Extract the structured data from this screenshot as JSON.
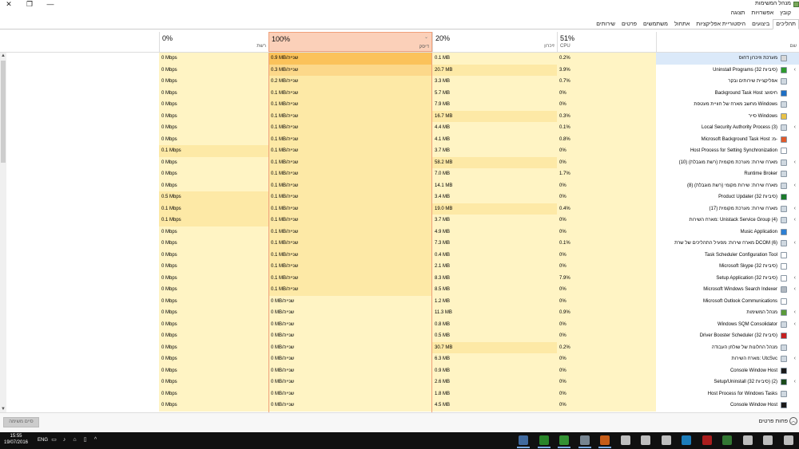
{
  "window": {
    "title": "מנהל המשימות",
    "close_label": "✕",
    "restore_label": "❐",
    "minimize_label": "—"
  },
  "menu": [
    "קובץ",
    "אפשרויות",
    "תצוגה"
  ],
  "tabs": [
    {
      "label": "תהליכים",
      "active": true
    },
    {
      "label": "ביצועים",
      "active": false
    },
    {
      "label": "היסטוריית אפליקציות",
      "active": false
    },
    {
      "label": "אתחול",
      "active": false
    },
    {
      "label": "משתמשים",
      "active": false
    },
    {
      "label": "פרטים",
      "active": false
    },
    {
      "label": "שירותים",
      "active": false
    }
  ],
  "columns": {
    "name": {
      "label": "שם"
    },
    "cpu": {
      "percent": "51%",
      "label": "CPU"
    },
    "memory": {
      "percent": "20%",
      "label": "זיכרון"
    },
    "disk": {
      "percent": "100%",
      "label": "דיסק"
    },
    "network": {
      "percent": "0%",
      "label": "רשת"
    }
  },
  "processes": [
    {
      "name": "מערכת וזיכרון דחוס",
      "cpu": "0.2%",
      "mem": "0.1 MB",
      "disk": "0.9 MB/שנייה",
      "net": "0 Mbps",
      "icon": "system-icon",
      "icon_color": "#d8d8d8",
      "expand": false,
      "selected": true
    },
    {
      "name": "Uninstall Programs (32 סיביות)",
      "cpu": "3.9%",
      "mem": "20.7 MB",
      "disk": "0.3 MB/שנייה",
      "net": "0 Mbps",
      "icon": "green-circle-icon",
      "icon_color": "#2e9a2e",
      "expand": true
    },
    {
      "name": "אפליקציית שירותים ובקר",
      "cpu": "0.7%",
      "mem": "3.3 MB",
      "disk": "0.2 MB/שנייה",
      "net": "0 Mbps",
      "icon": "services-icon",
      "icon_color": "#cfd8e0",
      "expand": false
    },
    {
      "name": "Background Task Host :חיפוש",
      "cpu": "0%",
      "mem": "5.7 MB",
      "disk": "0.1 MB/שנייה",
      "net": "0 Mbps",
      "icon": "search-app-icon",
      "icon_color": "#1e6fc4",
      "expand": false
    },
    {
      "name": "מחשב מארח של חוויית מעטפת Windows",
      "cpu": "0%",
      "mem": "7.9 MB",
      "disk": "0.1 MB/שנייה",
      "net": "0 Mbps",
      "icon": "window-frame-icon",
      "icon_color": "#cfd8e0",
      "expand": false
    },
    {
      "name": "סייר Windows",
      "cpu": "0.3%",
      "mem": "16.7 MB",
      "disk": "0.1 MB/שנייה",
      "net": "0 Mbps",
      "icon": "folder-icon",
      "icon_color": "#e8c248",
      "expand": false
    },
    {
      "name": "Local Security Authority Process (3)",
      "cpu": "0.1%",
      "mem": "4.4 MB",
      "disk": "0.1 MB/שנייה",
      "net": "0 Mbps",
      "icon": "window-frame-icon",
      "icon_color": "#cfd8e0",
      "expand": true
    },
    {
      "name": "Microsoft Background Task Host :מ-",
      "cpu": "0.8%",
      "mem": "4.1 MB",
      "disk": "0.1 MB/שנייה",
      "net": "0 Mbps",
      "icon": "windows-logo-icon",
      "icon_color": "#e05a2b",
      "expand": false
    },
    {
      "name": "Host Process for Setting Synchronization",
      "cpu": "0%",
      "mem": "3.7 MB",
      "disk": "0.1 MB/שנייה",
      "net": "0.1 Mbps",
      "icon": "window-frame-icon",
      "icon_color": "#ffffff",
      "expand": false
    },
    {
      "name": "מארח שירות: מערכת מקומית (רשת מוגבלת) (10)",
      "cpu": "0%",
      "mem": "58.2 MB",
      "disk": "0.1 MB/שנייה",
      "net": "0 Mbps",
      "icon": "service-host-icon",
      "icon_color": "#cfd8e0",
      "expand": true
    },
    {
      "name": "Runtime Broker",
      "cpu": "1.7%",
      "mem": "7.0 MB",
      "disk": "0.1 MB/שנייה",
      "net": "0 Mbps",
      "icon": "window-frame-icon",
      "icon_color": "#cfd8e0",
      "expand": false
    },
    {
      "name": "מארח שירות: שירות מקומי (רשת מוגבלת) (8)",
      "cpu": "0%",
      "mem": "14.1 MB",
      "disk": "0.1 MB/שנייה",
      "net": "0 Mbps",
      "icon": "service-host-icon",
      "icon_color": "#cfd8e0",
      "expand": true
    },
    {
      "name": "Product Updater (32 סיביות)",
      "cpu": "0%",
      "mem": "3.4 MB",
      "disk": "0.1 MB/שנייה",
      "net": "0.5 Mbps",
      "icon": "updater-icon",
      "icon_color": "#1a7a2a",
      "expand": false
    },
    {
      "name": "מארח שירות: מערכת מקומית (17)",
      "cpu": "0.4%",
      "mem": "19.0 MB",
      "disk": "0.1 MB/שנייה",
      "net": "0.1 Mbps",
      "icon": "service-host-icon",
      "icon_color": "#cfd8e0",
      "expand": true
    },
    {
      "name": "מארח השירות: Unistack Service Group (4)",
      "cpu": "0%",
      "mem": "3.7 MB",
      "disk": "0.1 MB/שנייה",
      "net": "0.1 Mbps",
      "icon": "service-host-icon",
      "icon_color": "#cfd8e0",
      "expand": true
    },
    {
      "name": "Music Application",
      "cpu": "0%",
      "mem": "4.9 MB",
      "disk": "0.1 MB/שנייה",
      "net": "0 Mbps",
      "icon": "music-icon",
      "icon_color": "#2d7fd3",
      "expand": false
    },
    {
      "name": "מארח שירות: מפעיל התהליכים של שרת DCOM (6)",
      "cpu": "0.1%",
      "mem": "7.3 MB",
      "disk": "0.1 MB/שנייה",
      "net": "0 Mbps",
      "icon": "service-host-icon",
      "icon_color": "#cfd8e0",
      "expand": true
    },
    {
      "name": "Task Scheduler Configuration Tool",
      "cpu": "0%",
      "mem": "0.4 MB",
      "disk": "0.1 MB/שנייה",
      "net": "0 Mbps",
      "icon": "window-frame-icon",
      "icon_color": "#ffffff",
      "expand": false
    },
    {
      "name": "Microsoft Skype (32 סיביות)",
      "cpu": "0%",
      "mem": "2.1 MB",
      "disk": "0.1 MB/שנייה",
      "net": "0 Mbps",
      "icon": "skype-icon",
      "icon_color": "#ffffff",
      "expand": false
    },
    {
      "name": "Setup Application (32 סיביות)",
      "cpu": "7.9%",
      "mem": "8.3 MB",
      "disk": "0.1 MB/שנייה",
      "net": "0 Mbps",
      "icon": "setup-icon",
      "icon_color": "#ffffff",
      "expand": true
    },
    {
      "name": "Microsoft Windows Search Indexer",
      "cpu": "0%",
      "mem": "8.5 MB",
      "disk": "0.1 MB/שנייה",
      "net": "0 Mbps",
      "icon": "indexer-icon",
      "icon_color": "#b0b8c0",
      "expand": true
    },
    {
      "name": "Microsoft Outlook Communications",
      "cpu": "0%",
      "mem": "1.2 MB",
      "disk": "0 MB/שנייה",
      "net": "0 Mbps",
      "icon": "window-frame-icon",
      "icon_color": "#ffffff",
      "expand": false
    },
    {
      "name": "מנהל המשימות",
      "cpu": "0.9%",
      "mem": "11.3 MB",
      "disk": "0 MB/שנייה",
      "net": "0 Mbps",
      "icon": "task-manager-icon",
      "icon_color": "#5a9a3a",
      "expand": true
    },
    {
      "name": "Windows SQM Consolidator",
      "cpu": "0%",
      "mem": "0.8 MB",
      "disk": "0 MB/שנייה",
      "net": "0 Mbps",
      "icon": "window-frame-icon",
      "icon_color": "#cfd8e0",
      "expand": true
    },
    {
      "name": "Driver Booster Scheduler (32 סיביות)",
      "cpu": "0%",
      "mem": "0.5 MB",
      "disk": "0 MB/שנייה",
      "net": "0 Mbps",
      "icon": "driver-booster-icon",
      "icon_color": "#c62020",
      "expand": false
    },
    {
      "name": "מנהל החלונות של שולחן העבודה",
      "cpu": "0.2%",
      "mem": "30.7 MB",
      "disk": "0 MB/שנייה",
      "net": "0 Mbps",
      "icon": "window-frame-icon",
      "icon_color": "#cfd8e0",
      "expand": false
    },
    {
      "name": "מארח השירות: UtcSvc",
      "cpu": "0%",
      "mem": "6.3 MB",
      "disk": "0 MB/שנייה",
      "net": "0 Mbps",
      "icon": "service-host-icon",
      "icon_color": "#cfd8e0",
      "expand": true
    },
    {
      "name": "Console Window Host",
      "cpu": "0%",
      "mem": "0.9 MB",
      "disk": "0 MB/שנייה",
      "net": "0 Mbps",
      "icon": "console-icon",
      "icon_color": "#1a1a1a",
      "expand": false
    },
    {
      "name": "Setup/Uninstall (32 סיביות) (2)",
      "cpu": "0%",
      "mem": "2.6 MB",
      "disk": "0 MB/שנייה",
      "net": "0 Mbps",
      "icon": "setup-uninstall-icon",
      "icon_color": "#1a4a1a",
      "expand": true
    },
    {
      "name": "Host Process for Windows Tasks",
      "cpu": "0%",
      "mem": "1.8 MB",
      "disk": "0 MB/שנייה",
      "net": "0 Mbps",
      "icon": "window-frame-icon",
      "icon_color": "#cfd8e0",
      "expand": false
    },
    {
      "name": "Console Window Host",
      "cpu": "0%",
      "mem": "4.5 MB",
      "disk": "0 MB/שנייה",
      "net": "0 Mbps",
      "icon": "console-icon",
      "icon_color": "#1a1a1a",
      "expand": false
    }
  ],
  "footer": {
    "fewer_details": "פחות פרטים",
    "end_task": "סיים משימה"
  },
  "taskbar": {
    "time": "15:55",
    "date": "19/07/2016",
    "language": "ENG",
    "pinned": [
      {
        "name": "task-view-icon",
        "color": "#4a7ab8"
      },
      {
        "name": "green-circle-app-icon",
        "color": "#2e9a2e"
      },
      {
        "name": "uninstall-app-icon",
        "color": "#3aa83a"
      },
      {
        "name": "task-manager-app-icon",
        "color": "#8a9aa8"
      },
      {
        "name": "firefox-icon",
        "color": "#e66a1a"
      },
      {
        "name": "mo-app-icon",
        "color": "#dddddd"
      },
      {
        "name": "mail-icon",
        "color": "#dddddd"
      },
      {
        "name": "store-icon",
        "color": "#dddddd"
      },
      {
        "name": "skype-app-icon",
        "color": "#1e8fd8"
      },
      {
        "name": "driver-booster-app-icon",
        "color": "#c62020"
      },
      {
        "name": "photos-icon",
        "color": "#3a8a3a"
      },
      {
        "name": "tablet-icon",
        "color": "#dddddd"
      },
      {
        "name": "explorer-icon",
        "color": "#dddddd"
      },
      {
        "name": "search-icon",
        "color": "#dddddd"
      },
      {
        "name": "start-icon",
        "color": "#dddddd"
      }
    ]
  },
  "colors": {
    "disk_header": "#fbd0b9",
    "heat_light": "#fff4c4",
    "heat_mid": "#fde9a6",
    "heat_strong": "#fcd88a",
    "heat_hot": "#fbc25a",
    "selected_row": "#dbe9f9"
  }
}
